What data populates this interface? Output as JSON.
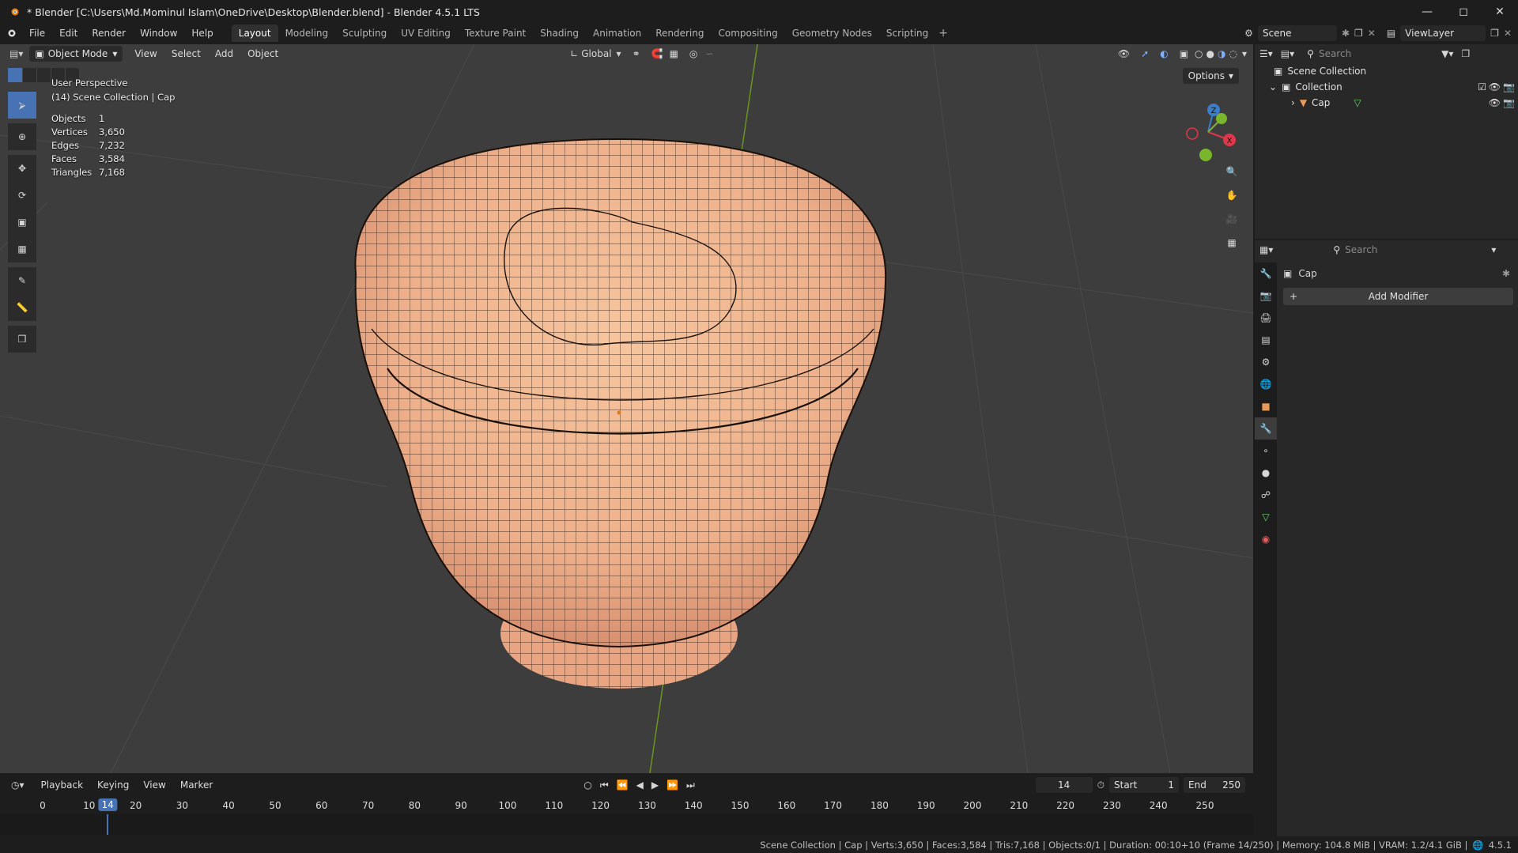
{
  "window": {
    "title": "* Blender [C:\\Users\\Md.Mominul Islam\\OneDrive\\Desktop\\Blender.blend] - Blender 4.5.1 LTS",
    "controls": [
      "minimize-icon",
      "maximize-icon",
      "close-icon"
    ]
  },
  "menubar": {
    "menus": [
      "File",
      "Edit",
      "Render",
      "Window",
      "Help"
    ],
    "workspaces": [
      "Layout",
      "Modeling",
      "Sculpting",
      "UV Editing",
      "Texture Paint",
      "Shading",
      "Animation",
      "Rendering",
      "Compositing",
      "Geometry Nodes",
      "Scripting"
    ],
    "active_workspace": "Layout",
    "scene": "Scene",
    "view_layer": "ViewLayer"
  },
  "viewport": {
    "mode": "Object Mode",
    "menus": [
      "View",
      "Select",
      "Add",
      "Object"
    ],
    "orientation": "Global",
    "options_label": "Options",
    "overlay_title": "User Perspective",
    "overlay_subtitle": "(14) Scene Collection | Cap",
    "stats": [
      {
        "label": "Objects",
        "value": "1"
      },
      {
        "label": "Vertices",
        "value": "3,650"
      },
      {
        "label": "Edges",
        "value": "7,232"
      },
      {
        "label": "Faces",
        "value": "3,584"
      },
      {
        "label": "Triangles",
        "value": "7,168"
      }
    ],
    "gizmo_axes": [
      "Z",
      "X"
    ],
    "colors": {
      "background": "#3d3d3d",
      "mesh": "#f0b48a",
      "wire": "#1a1008",
      "axis_x": "#e0364a",
      "axis_y": "#7ab62c",
      "axis_z": "#3a7ec9"
    }
  },
  "outliner": {
    "search_placeholder": "Search",
    "root": "Scene Collection",
    "collection": "Collection",
    "object": "Cap"
  },
  "properties": {
    "search_placeholder": "Search",
    "object_name": "Cap",
    "add_modifier_label": "Add Modifier",
    "active_tab": "modifier-tab"
  },
  "timeline": {
    "menus": [
      "Playback",
      "Keying",
      "View",
      "Marker"
    ],
    "current_frame": "14",
    "start_label": "Start",
    "start": "1",
    "end_label": "End",
    "end": "250",
    "ticks": [
      "0",
      "10",
      "20",
      "30",
      "40",
      "50",
      "60",
      "70",
      "80",
      "90",
      "100",
      "110",
      "120",
      "130",
      "140",
      "150",
      "160",
      "170",
      "180",
      "190",
      "200",
      "210",
      "220",
      "230",
      "240",
      "250"
    ],
    "playhead_label": "14"
  },
  "statusbar": {
    "text": "Scene Collection | Cap | Verts:3,650 | Faces:3,584 | Tris:7,168 | Objects:0/1 | Duration: 00:10+10 (Frame 14/250) | Memory: 104.8 MiB | VRAM: 1.2/4.1 GiB |",
    "version": "4.5.1"
  }
}
